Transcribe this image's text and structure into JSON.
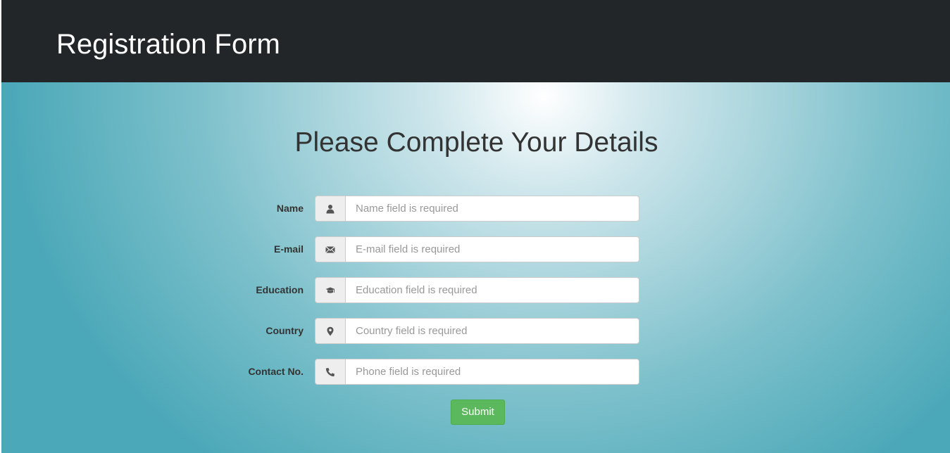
{
  "navbar": {
    "brand": "Registration Form"
  },
  "main": {
    "heading": "Please Complete Your Details"
  },
  "form": {
    "fields": [
      {
        "label": "Name",
        "icon": "user-icon",
        "placeholder": "Name field is required"
      },
      {
        "label": "E-mail",
        "icon": "envelope-icon",
        "placeholder": "E-mail field is required"
      },
      {
        "label": "Education",
        "icon": "graduation-cap-icon",
        "placeholder": "Education field is required"
      },
      {
        "label": "Country",
        "icon": "map-marker-icon",
        "placeholder": "Country field is required"
      },
      {
        "label": "Contact No.",
        "icon": "phone-icon",
        "placeholder": "Phone field is required"
      }
    ],
    "submit_label": "Submit"
  },
  "colors": {
    "navbar_bg": "#222629",
    "submit_bg": "#5cb85c",
    "page_teal": "#4ba8b8"
  }
}
